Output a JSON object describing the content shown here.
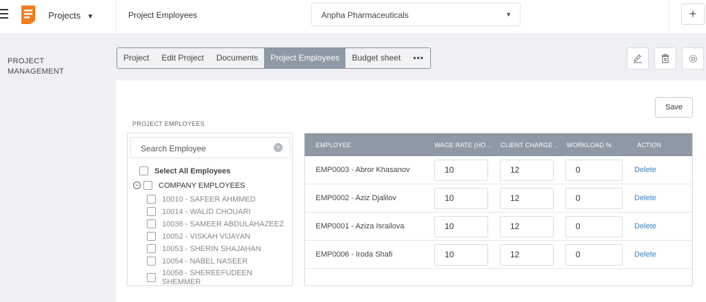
{
  "header": {
    "module": "Projects",
    "page_title": "Project Employees",
    "company": "Anpha Pharmaceuticals",
    "add_label": "+"
  },
  "sidebar": {
    "section_line1": "PROJECT",
    "section_line2": "MANAGEMENT"
  },
  "tabs": [
    {
      "label": "Project"
    },
    {
      "label": "Edit Project"
    },
    {
      "label": "Documents"
    },
    {
      "label": "Project Employees"
    },
    {
      "label": "Budget sheet"
    },
    {
      "label": "•••"
    }
  ],
  "card": {
    "save_label": "Save",
    "section_title": "PROJECT EMPLOYEES"
  },
  "picker": {
    "search_placeholder": "Search Employee",
    "clear_glyph": "×",
    "select_all": "Select All Employees",
    "group_toggle": "−",
    "group": "COMPANY EMPLOYEES",
    "employees": [
      "10010 - SAFEER AHMMED",
      "10014 - WALID CHOUARI",
      "10036 - SAMEER ABDULAHAZEEZ",
      "10052 - VISKAH VIJAYAN",
      "10053 - SHERIN SHAJAHAN",
      "10054 - NABEL NASEER",
      "10058 - SHEREEFUDEEN",
      "SHEMMER"
    ]
  },
  "table": {
    "headers": [
      "EMPLOYEE",
      "WAGE RATE (HO...",
      "CLIENT CHARGE ...",
      "WORKLOAD %",
      "ACTION"
    ],
    "rows": [
      {
        "employee": "EMP0003 - Abror Khasanov",
        "wage": "10",
        "charge": "12",
        "workload": "0",
        "action": "Delete"
      },
      {
        "employee": "EMP0002 - Aziz Djalilov",
        "wage": "10",
        "charge": "12",
        "workload": "0",
        "action": "Delete"
      },
      {
        "employee": "EMP0001 - Aziza Israilova",
        "wage": "10",
        "charge": "12",
        "workload": "0",
        "action": "Delete"
      },
      {
        "employee": "EMP0006 - Iroda Shafi",
        "wage": "10",
        "charge": "12",
        "workload": "0",
        "action": "Delete"
      }
    ]
  },
  "colors": {
    "accent": "#8f98a5",
    "link": "#3a7fbf",
    "logo": "#f07d1e"
  }
}
